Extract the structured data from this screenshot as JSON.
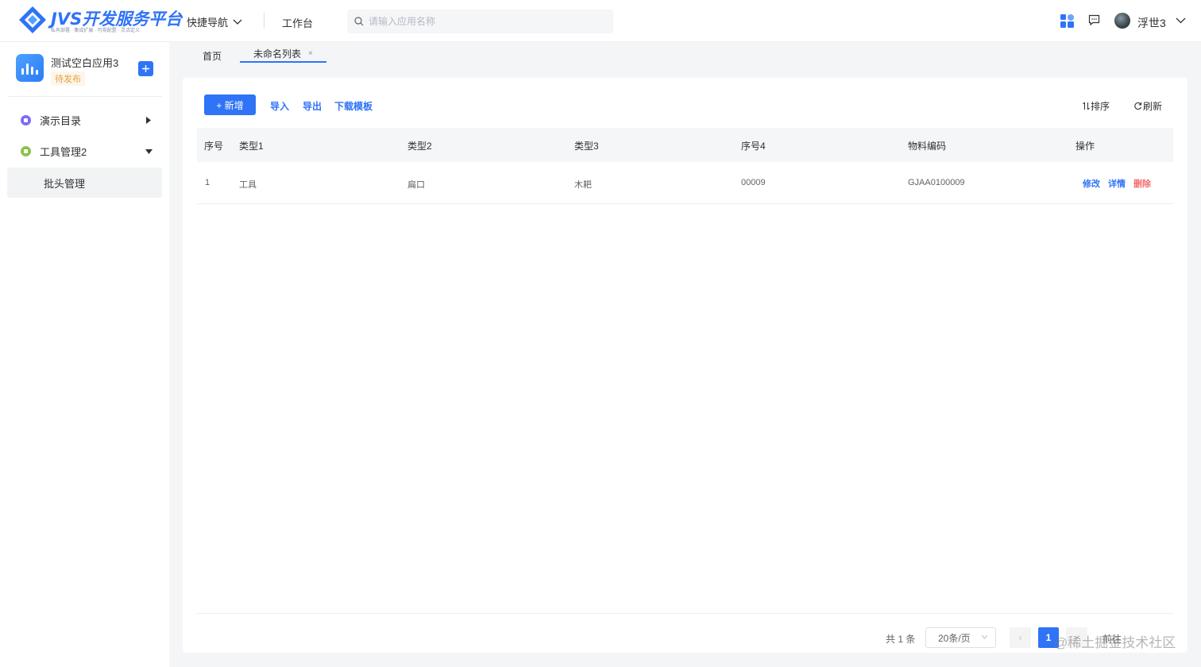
{
  "header": {
    "logo_title": "JVS开发服务平台",
    "logo_subtitle": "私有部署 · 集成扩展 · 可视配置 · 灵活定义",
    "quick_nav": "快捷导航",
    "workbench": "工作台",
    "search_placeholder": "请输入应用名称",
    "username": "浮世3",
    "icons": [
      "apps-grid-icon",
      "message-icon",
      "chevron-down-icon"
    ]
  },
  "sidebar": {
    "app_name": "测试空白应用3",
    "app_status": "待发布",
    "add_icon": "plus-icon",
    "items": [
      {
        "label": "演示目录",
        "icon": "dot-purple",
        "color": "#7b6cf6",
        "expanded": false
      },
      {
        "label": "工具管理2",
        "icon": "dot-green",
        "color": "#8bc34a",
        "expanded": true
      }
    ],
    "sub_items": [
      {
        "label": "批头管理",
        "active": true
      }
    ]
  },
  "tabs": [
    {
      "label": "首页",
      "active": false
    },
    {
      "label": "未命名列表",
      "active": true,
      "closable": "×"
    }
  ],
  "toolbar": {
    "add_label": "+ 新增",
    "import_label": "导入",
    "export_label": "导出",
    "template_label": "下载模板",
    "sort_label": "排序",
    "refresh_label": "刷新"
  },
  "table": {
    "columns": [
      "序号",
      "类型1",
      "类型2",
      "类型3",
      "序号4",
      "物料编码",
      "操作"
    ],
    "rows": [
      {
        "index": "1",
        "type1": "工具",
        "type2": "扁口",
        "type3": "木耙",
        "seq4": "00009",
        "code": "GJAA0100009"
      }
    ],
    "actions": {
      "edit": "修改",
      "detail": "详情",
      "delete": "删除"
    }
  },
  "pagination": {
    "total": "共 1 条",
    "page_size": "20条/页",
    "prev": "‹",
    "current": "1",
    "next": "›",
    "goto": "前往"
  },
  "watermark": "@稀土掘金技术社区",
  "colors": {
    "primary": "#2f73f6",
    "danger": "#f56c6c",
    "warning": "#e6a23c"
  }
}
